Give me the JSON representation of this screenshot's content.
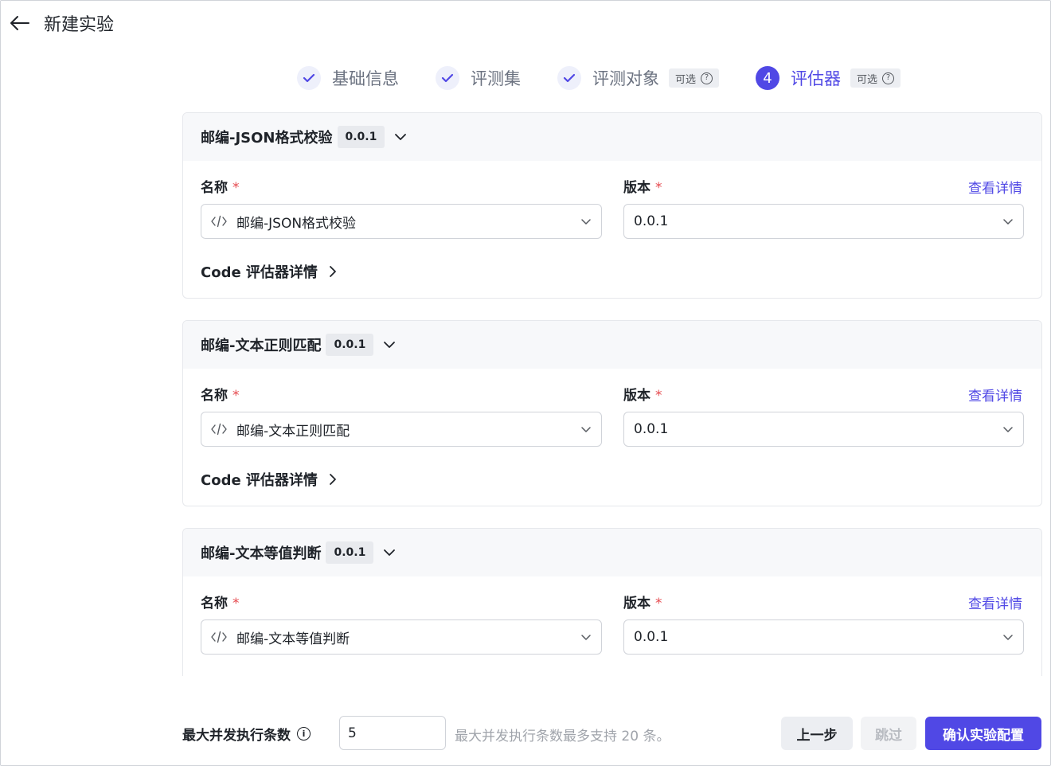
{
  "header": {
    "title": "新建实验"
  },
  "steps": [
    {
      "label": "基础信息",
      "state": "done"
    },
    {
      "label": "评测集",
      "state": "done"
    },
    {
      "label": "评测对象",
      "state": "done",
      "badge": "可选"
    },
    {
      "number": "4",
      "label": "评估器",
      "state": "active",
      "badge": "可选"
    }
  ],
  "labels": {
    "name": "名称",
    "version": "版本",
    "required_mark": "*",
    "detail_link": "查看详情",
    "code_detail": "Code 评估器详情"
  },
  "evaluators": [
    {
      "title": "邮编-JSON格式校验",
      "version_tag": "0.0.1",
      "name_value": "邮编-JSON格式校验",
      "version_value": "0.0.1"
    },
    {
      "title": "邮编-文本正则匹配",
      "version_tag": "0.0.1",
      "name_value": "邮编-文本正则匹配",
      "version_value": "0.0.1"
    },
    {
      "title": "邮编-文本等值判断",
      "version_tag": "0.0.1",
      "name_value": "邮编-文本等值判断",
      "version_value": "0.0.1"
    }
  ],
  "footer": {
    "concurrency_label": "最大并发执行条数",
    "concurrency_value": "5",
    "hint": "最大并发执行条数最多支持 20 条。",
    "prev_label": "上一步",
    "skip_label": "跳过",
    "confirm_label": "确认实验配置"
  },
  "colors": {
    "accent": "#5048e5",
    "required": "#e5484d",
    "link": "#5048e5"
  }
}
